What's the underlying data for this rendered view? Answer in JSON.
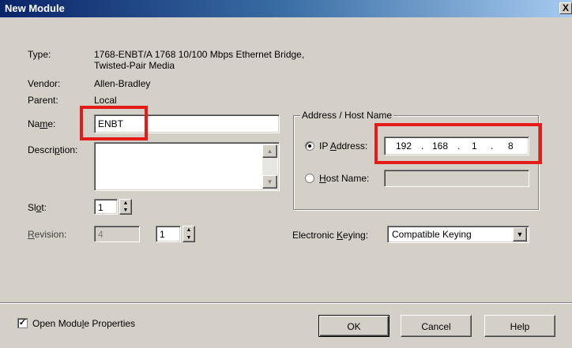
{
  "window": {
    "title": "New Module",
    "close_glyph": "X"
  },
  "type": {
    "label": "Type:",
    "line1": "1768-ENBT/A 1768 10/100 Mbps Ethernet Bridge,",
    "line2": "Twisted-Pair Media"
  },
  "vendor": {
    "label": "Vendor:",
    "value": "Allen-Bradley"
  },
  "parent": {
    "label": "Parent:",
    "value": "Local"
  },
  "name": {
    "label_pre": "Na",
    "label_u": "m",
    "label_post": "e:",
    "value": "ENBT"
  },
  "description": {
    "label_pre": "Descri",
    "label_u": "p",
    "label_post": "tion:",
    "value": ""
  },
  "slot": {
    "label_pre": "Sl",
    "label_u": "o",
    "label_post": "t:",
    "value": "1"
  },
  "revision": {
    "label_u": "R",
    "label_post": "evision:",
    "major": "4",
    "minor": "1"
  },
  "address_group": {
    "title": "Address / Host Name",
    "ip_label_pre": "IP ",
    "ip_label_u": "A",
    "ip_label_post": "ddress:",
    "ip": [
      "192",
      "168",
      "1",
      "8"
    ],
    "host_label_u": "H",
    "host_label_post": "ost Name:",
    "host_value": ""
  },
  "keying": {
    "label_pre": "Electronic ",
    "label_u": "K",
    "label_post": "eying:",
    "value": "Compatible Keying"
  },
  "open_props": {
    "label_pre": "Open Modu",
    "label_u": "l",
    "label_post": "e Properties",
    "checked": true
  },
  "buttons": {
    "ok": "OK",
    "cancel": "Cancel",
    "help": "Help"
  },
  "colors": {
    "highlight": "#e41b17",
    "title_bar": "#0a246a",
    "dialog_bg": "#d4d0c8"
  },
  "icons": {
    "spin_up": "up-arrow-icon",
    "spin_down": "down-arrow-icon",
    "dropdown": "chevron-down-icon"
  }
}
